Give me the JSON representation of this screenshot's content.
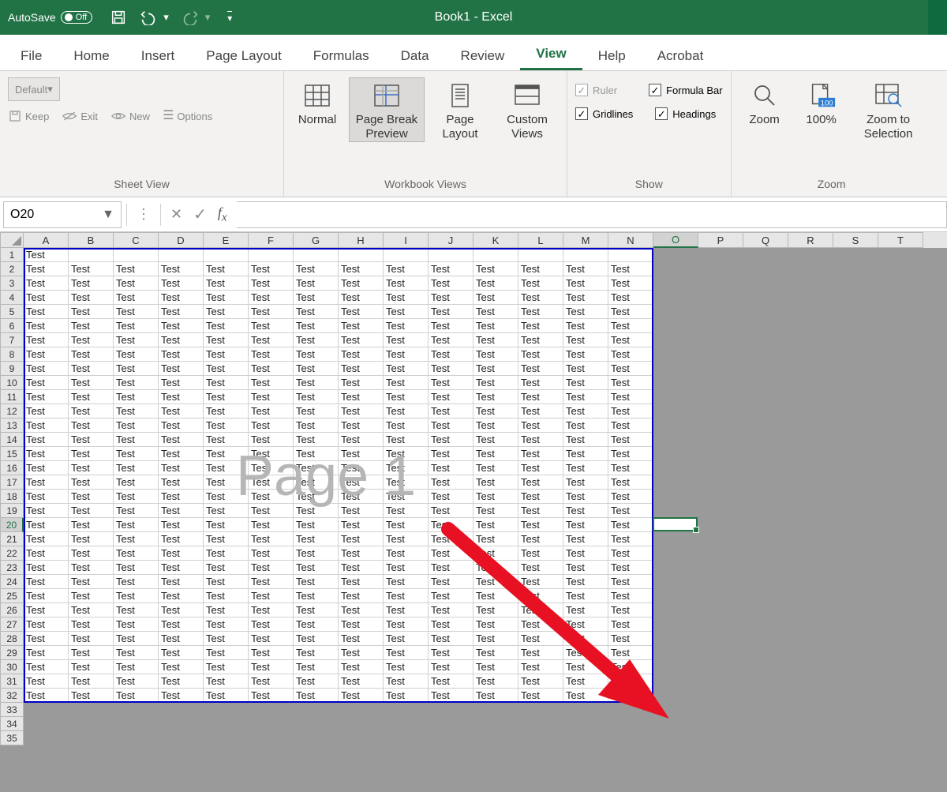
{
  "title": "Book1 - Excel",
  "autosave": {
    "label": "AutoSave",
    "state": "Off"
  },
  "tabs": [
    "File",
    "Home",
    "Insert",
    "Page Layout",
    "Formulas",
    "Data",
    "Review",
    "View",
    "Help",
    "Acrobat"
  ],
  "active_tab": "View",
  "sheet_view": {
    "dropdown": "Default",
    "keep": "Keep",
    "exit": "Exit",
    "new": "New",
    "options": "Options",
    "group_label": "Sheet View"
  },
  "workbook_views": {
    "normal": "Normal",
    "page_break": "Page Break Preview",
    "page_layout": "Page Layout",
    "custom_views": "Custom Views",
    "group_label": "Workbook Views",
    "active": "page_break"
  },
  "show": {
    "ruler": "Ruler",
    "gridlines": "Gridlines",
    "formula_bar": "Formula Bar",
    "headings": "Headings",
    "group_label": "Show",
    "checked": {
      "ruler": true,
      "gridlines": true,
      "formula_bar": true,
      "headings": true
    },
    "disabled": {
      "ruler": true
    }
  },
  "zoom": {
    "zoom": "Zoom",
    "hundred": "100%",
    "to_selection": "Zoom to Selection",
    "group_label": "Zoom"
  },
  "name_box": "O20",
  "columns": [
    "A",
    "B",
    "C",
    "D",
    "E",
    "F",
    "G",
    "H",
    "I",
    "J",
    "K",
    "L",
    "M",
    "N",
    "O",
    "P",
    "Q",
    "R",
    "S",
    "T"
  ],
  "selected_col": "O",
  "selected_row": 20,
  "row_count": 35,
  "print_rows": 32,
  "print_cols": 14,
  "cell_value": "Test",
  "watermark": "Page 1",
  "a1_only_first_row": true
}
